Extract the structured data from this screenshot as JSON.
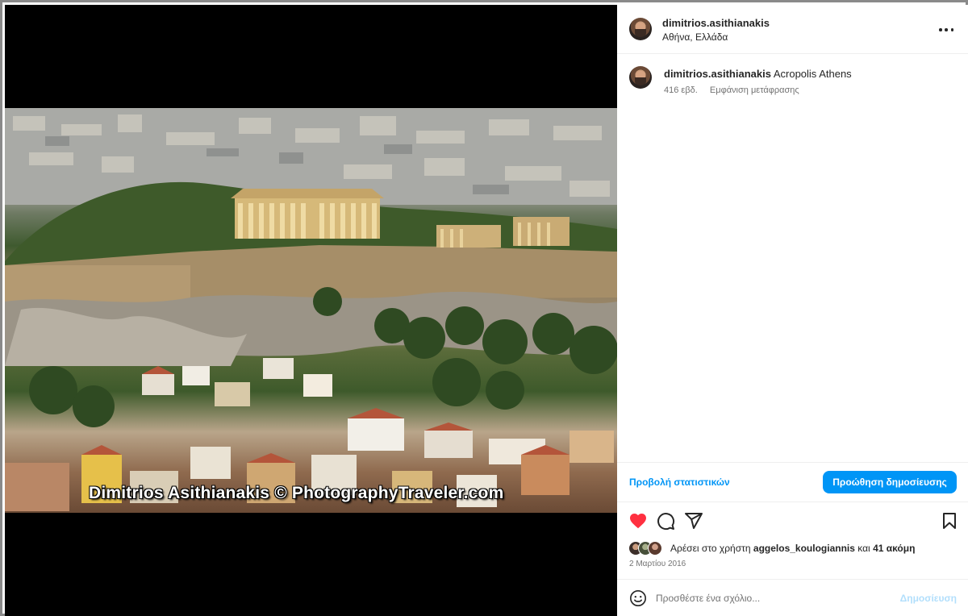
{
  "header": {
    "username": "dimitrios.asithianakis",
    "location": "Αθήνα, Ελλάδα",
    "more_icon": "more-horizontal-icon"
  },
  "media": {
    "watermark": "Dimitrios Asithianakis © PhotographyTraveler.com"
  },
  "caption": {
    "username": "dimitrios.asithianakis",
    "text": "Acropolis Athens",
    "age": "416 εβδ.",
    "translate": "Εμφάνιση μετάφρασης"
  },
  "insights": {
    "view_label": "Προβολή στατιστικών",
    "boost_label": "Προώθηση δημοσίευσης"
  },
  "actions": {
    "like_icon": "heart-filled-icon",
    "comment_icon": "comment-icon",
    "share_icon": "share-icon",
    "save_icon": "bookmark-icon",
    "like_color": "#ff3040"
  },
  "likes": {
    "prefix": "Αρέσει στο χρήστη",
    "user": "aggelos_koulogiannis",
    "conjunction": "και",
    "others": "41 ακόμη"
  },
  "date": "2 Μαρτίου 2016",
  "comment": {
    "placeholder": "Προσθέστε ένα σχόλιο...",
    "post_label": "Δημοσίευση"
  },
  "colors": {
    "accent": "#0095f6",
    "post_disabled": "#b2dffc",
    "muted": "#737373"
  }
}
